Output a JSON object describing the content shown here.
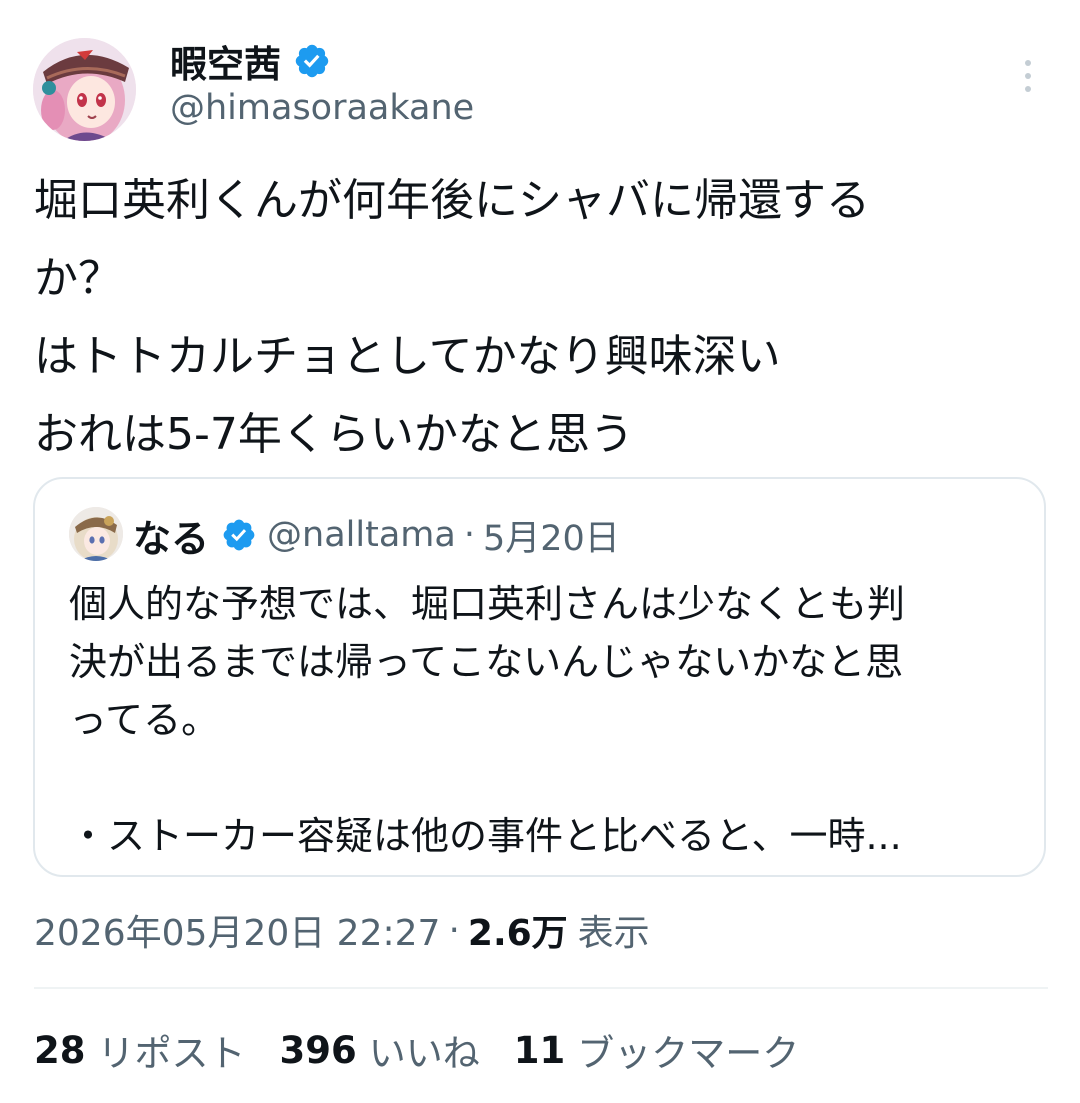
{
  "author": {
    "display_name": "暇空茜",
    "handle": "@himasoraakane",
    "verified_icon": "verified-badge-icon",
    "avatar_icon": "anime-girl-avatar"
  },
  "tweet": {
    "text_lines": [
      "堀口英利くんが何年後にシャバに帰還する",
      "か？",
      "はトトカルチョとしてかなり興味深い",
      "おれは5-7年くらいかなと思う"
    ]
  },
  "quote": {
    "display_name": "なる",
    "handle": "@nalltama",
    "separator": "·",
    "date": "5月20日",
    "avatar_icon": "anime-girl-avatar",
    "text_lines": [
      "個人的な予想では、堀口英利さんは少なくとも判",
      "決が出るまでは帰ってこないんじゃないかなと思",
      "ってる。",
      "",
      "・ストーカー容疑は他の事件と比べると、一時..."
    ]
  },
  "meta": {
    "timestamp": "2026年05月20日 22:27",
    "separator": "·",
    "views_count": "2.6万",
    "views_label": "表示"
  },
  "stats": {
    "reposts_count": "28",
    "reposts_label": "リポスト",
    "likes_count": "396",
    "likes_label": "いいね",
    "bookmarks_count": "11",
    "bookmarks_label": "ブックマーク"
  },
  "colors": {
    "text_primary": "#0f1419",
    "text_secondary": "#536471",
    "verified_blue": "#1d9bf0",
    "border": "#e1e8ed"
  }
}
